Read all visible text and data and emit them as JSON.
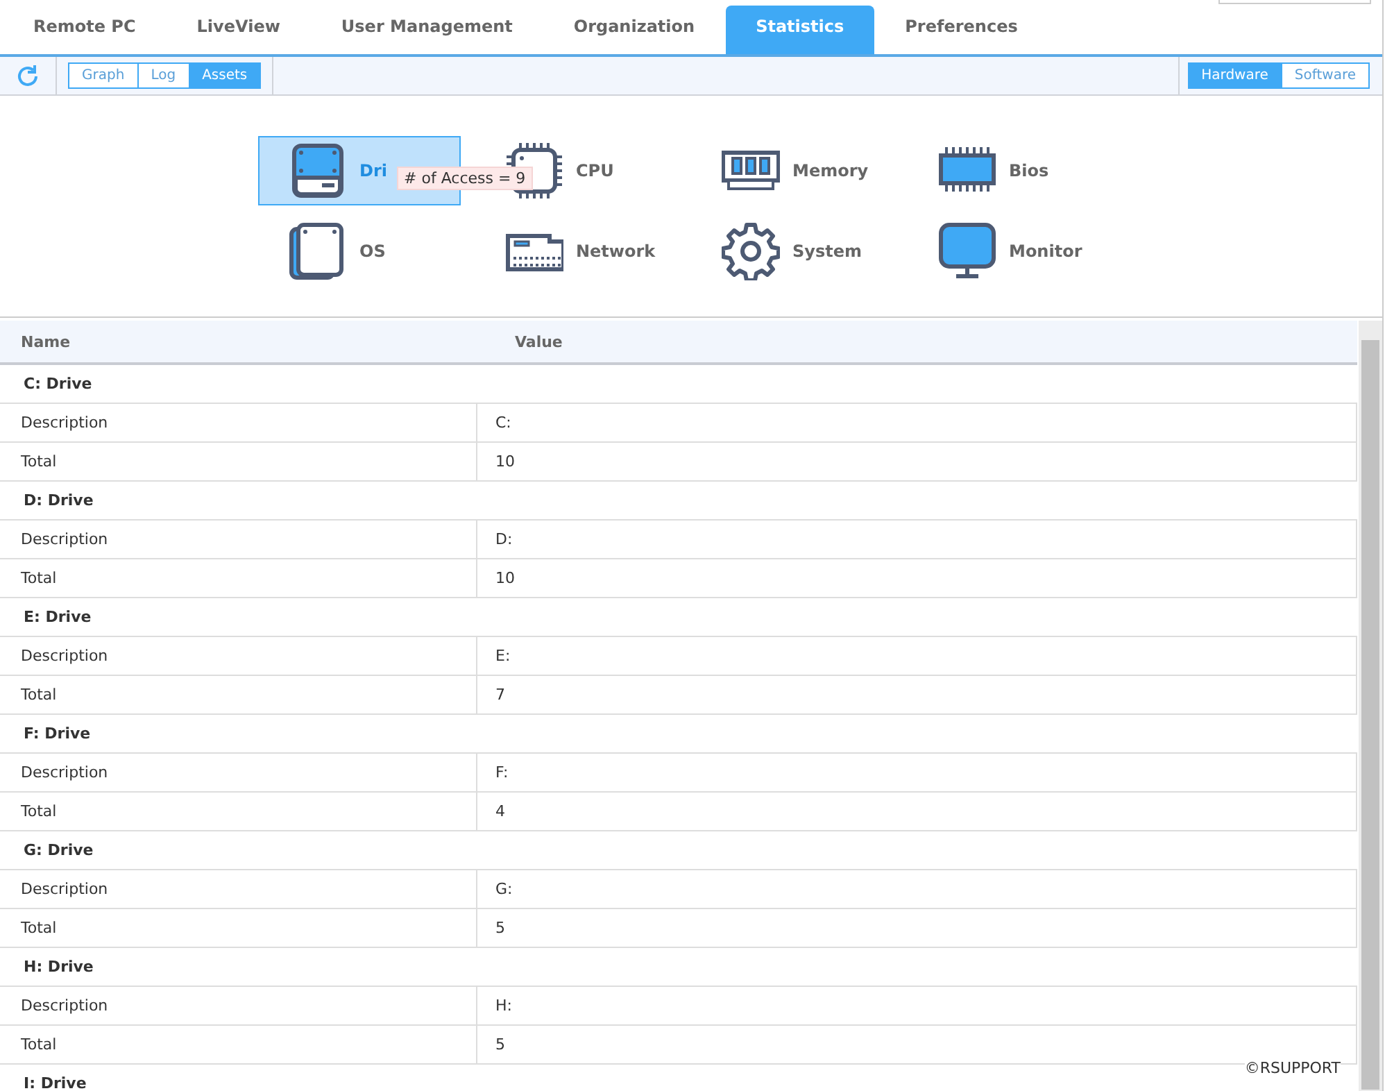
{
  "tabs": [
    {
      "label": "Remote PC",
      "selected": false
    },
    {
      "label": "LiveView",
      "selected": false
    },
    {
      "label": "User Management",
      "selected": false
    },
    {
      "label": "Organization",
      "selected": false
    },
    {
      "label": "Statistics",
      "selected": true
    },
    {
      "label": "Preferences",
      "selected": false
    }
  ],
  "views": [
    {
      "label": "Graph",
      "selected": false
    },
    {
      "label": "Log",
      "selected": false
    },
    {
      "label": "Assets",
      "selected": true
    }
  ],
  "categories": [
    {
      "label": "Hardware",
      "selected": true
    },
    {
      "label": "Software",
      "selected": false
    }
  ],
  "assets": [
    {
      "kind": "drive",
      "label": "Dri",
      "selected": true,
      "tooltip": "# of Access = 9"
    },
    {
      "kind": "cpu",
      "label": "CPU",
      "selected": false
    },
    {
      "kind": "memory",
      "label": "Memory",
      "selected": false
    },
    {
      "kind": "bios",
      "label": "Bios",
      "selected": false
    },
    {
      "kind": "os",
      "label": "OS",
      "selected": false
    },
    {
      "kind": "network",
      "label": "Network",
      "selected": false
    },
    {
      "kind": "system",
      "label": "System",
      "selected": false
    },
    {
      "kind": "monitor",
      "label": "Monitor",
      "selected": false
    }
  ],
  "table": {
    "columns": [
      "Name",
      "Value"
    ],
    "groups": [
      {
        "title": "C: Drive",
        "rows": [
          [
            "Description",
            "C:"
          ],
          [
            "Total",
            "10"
          ]
        ]
      },
      {
        "title": "D: Drive",
        "rows": [
          [
            "Description",
            "D:"
          ],
          [
            "Total",
            "10"
          ]
        ]
      },
      {
        "title": "E: Drive",
        "rows": [
          [
            "Description",
            "E:"
          ],
          [
            "Total",
            "7"
          ]
        ]
      },
      {
        "title": "F: Drive",
        "rows": [
          [
            "Description",
            "F:"
          ],
          [
            "Total",
            "4"
          ]
        ]
      },
      {
        "title": "G: Drive",
        "rows": [
          [
            "Description",
            "G:"
          ],
          [
            "Total",
            "5"
          ]
        ]
      },
      {
        "title": "H: Drive",
        "rows": [
          [
            "Description",
            "H:"
          ],
          [
            "Total",
            "5"
          ]
        ]
      },
      {
        "title": "I: Drive"
      }
    ]
  },
  "copyright": "©RSUPPORT"
}
